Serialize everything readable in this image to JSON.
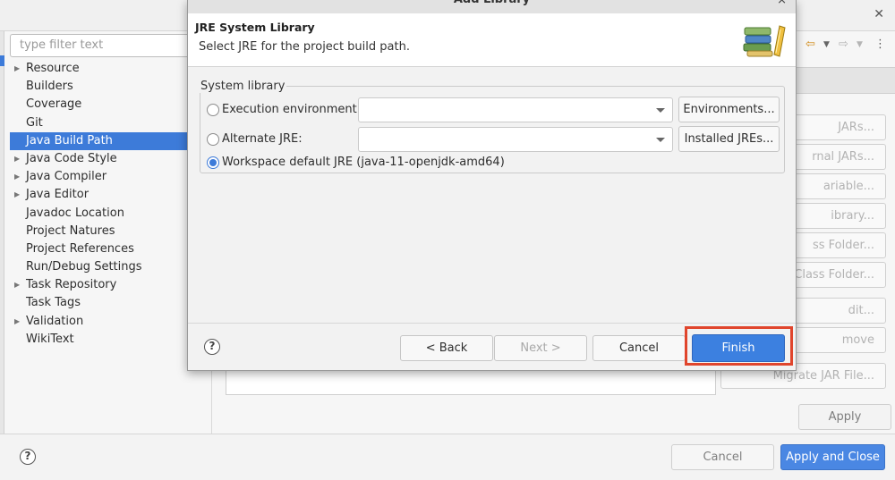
{
  "background": {
    "filter_placeholder": "type filter text",
    "nav_items": [
      {
        "label": "Resource",
        "arrow": true
      },
      {
        "label": "Builders",
        "arrow": false
      },
      {
        "label": "Coverage",
        "arrow": false
      },
      {
        "label": "Git",
        "arrow": false
      },
      {
        "label": "Java Build Path",
        "arrow": false,
        "selected": true
      },
      {
        "label": "Java Code Style",
        "arrow": true
      },
      {
        "label": "Java Compiler",
        "arrow": true
      },
      {
        "label": "Java Editor",
        "arrow": true
      },
      {
        "label": "Javadoc Location",
        "arrow": false
      },
      {
        "label": "Project Natures",
        "arrow": false
      },
      {
        "label": "Project References",
        "arrow": false
      },
      {
        "label": "Run/Debug Settings",
        "arrow": false
      },
      {
        "label": "Task Repository",
        "arrow": true
      },
      {
        "label": "Task Tags",
        "arrow": false
      },
      {
        "label": "Validation",
        "arrow": true
      },
      {
        "label": "WikiText",
        "arrow": false
      }
    ],
    "side_buttons": [
      "JARs...",
      "rnal JARs...",
      "ariable...",
      "ibrary...",
      "ss Folder...",
      "l Class Folder...",
      "dit...",
      "move",
      "Migrate JAR File..."
    ],
    "apply_label": "Apply",
    "cancel_label": "Cancel",
    "apply_close_label": "Apply and Close",
    "help_glyph": "?"
  },
  "dialog": {
    "title": "Add Library",
    "close_glyph": "×",
    "header_title": "JRE System Library",
    "header_description": "Select JRE for the project build path.",
    "group_label": "System library",
    "options": {
      "execution_env_label": "Execution environment:",
      "alternate_jre_label": "Alternate JRE:",
      "workspace_default_label": "Workspace default JRE (java-11-openjdk-amd64)",
      "selected": "workspace_default"
    },
    "environments_button": "Environments...",
    "installed_jres_button": "Installed JREs...",
    "back_button": "< Back",
    "next_button": "Next >",
    "cancel_button": "Cancel",
    "finish_button": "Finish",
    "help_glyph": "?"
  },
  "colors": {
    "accent": "#3d7bd9",
    "highlight": "#e0452c"
  }
}
